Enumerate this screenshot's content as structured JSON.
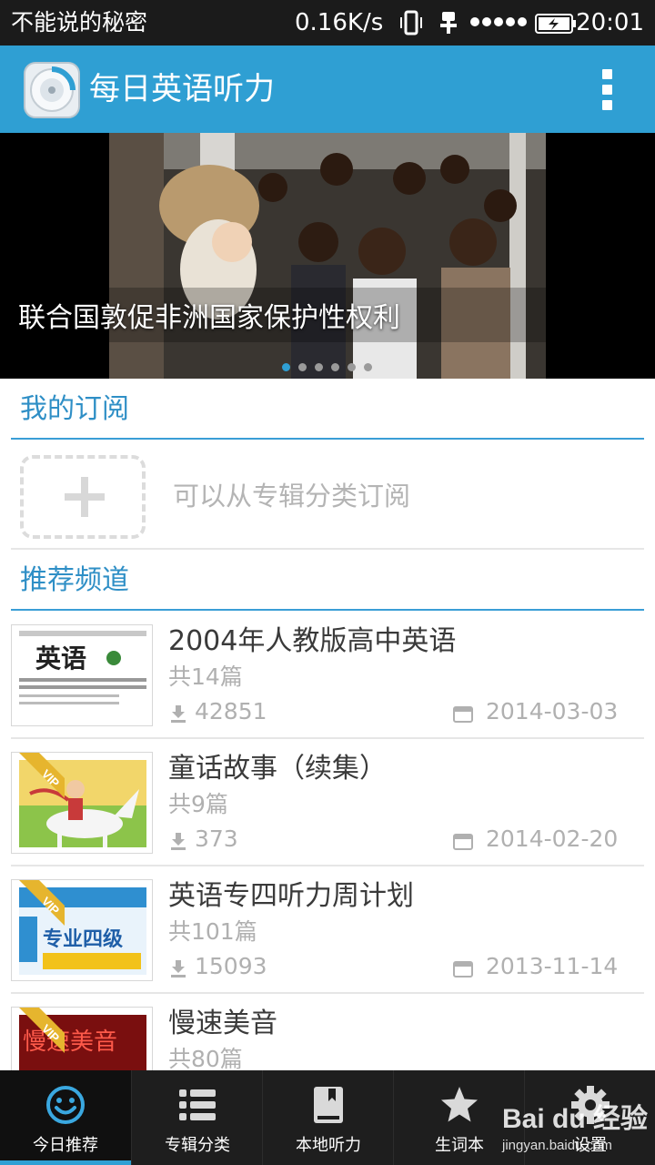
{
  "status_bar": {
    "carrier": "不能说的秘密",
    "speed": "0.16K/s",
    "time": "20:01",
    "icons": [
      "vibrate-icon",
      "usb-icon",
      "signal-icon",
      "battery-charging-icon"
    ]
  },
  "app_bar": {
    "title": "每日英语听力",
    "accent_color": "#2f9fd3"
  },
  "banner": {
    "caption": "联合国敦促非洲国家保护性权利",
    "dots_count": 6,
    "active_dot": 0
  },
  "subscriptions": {
    "title": "我的订阅",
    "empty_hint": "可以从专辑分类订阅"
  },
  "recommended": {
    "title": "推荐频道",
    "channels": [
      {
        "title": "2004年人教版高中英语",
        "count": "共14篇",
        "downloads": "42851",
        "date": "2014-03-03",
        "vip": false,
        "thumb_text": "英语"
      },
      {
        "title": "童话故事（续集）",
        "count": "共9篇",
        "downloads": "373",
        "date": "2014-02-20",
        "vip": true,
        "thumb_text": ""
      },
      {
        "title": "英语专四听力周计划",
        "count": "共101篇",
        "downloads": "15093",
        "date": "2013-11-14",
        "vip": true,
        "thumb_text": "专业四级"
      },
      {
        "title": "慢速美音",
        "count": "共80篇",
        "downloads": "",
        "date": "",
        "vip": true,
        "thumb_text": "慢速美音"
      }
    ]
  },
  "bottom_nav": {
    "items": [
      {
        "label": "今日推荐",
        "icon": "smiley-icon",
        "active": true
      },
      {
        "label": "专辑分类",
        "icon": "list-icon",
        "active": false
      },
      {
        "label": "本地听力",
        "icon": "book-icon",
        "active": false
      },
      {
        "label": "生词本",
        "icon": "star-icon",
        "active": false
      },
      {
        "label": "设置",
        "icon": "gear-icon",
        "active": false
      }
    ]
  },
  "watermark": {
    "logo": "Bai du 经验",
    "url": "jingyan.baidu.com"
  }
}
